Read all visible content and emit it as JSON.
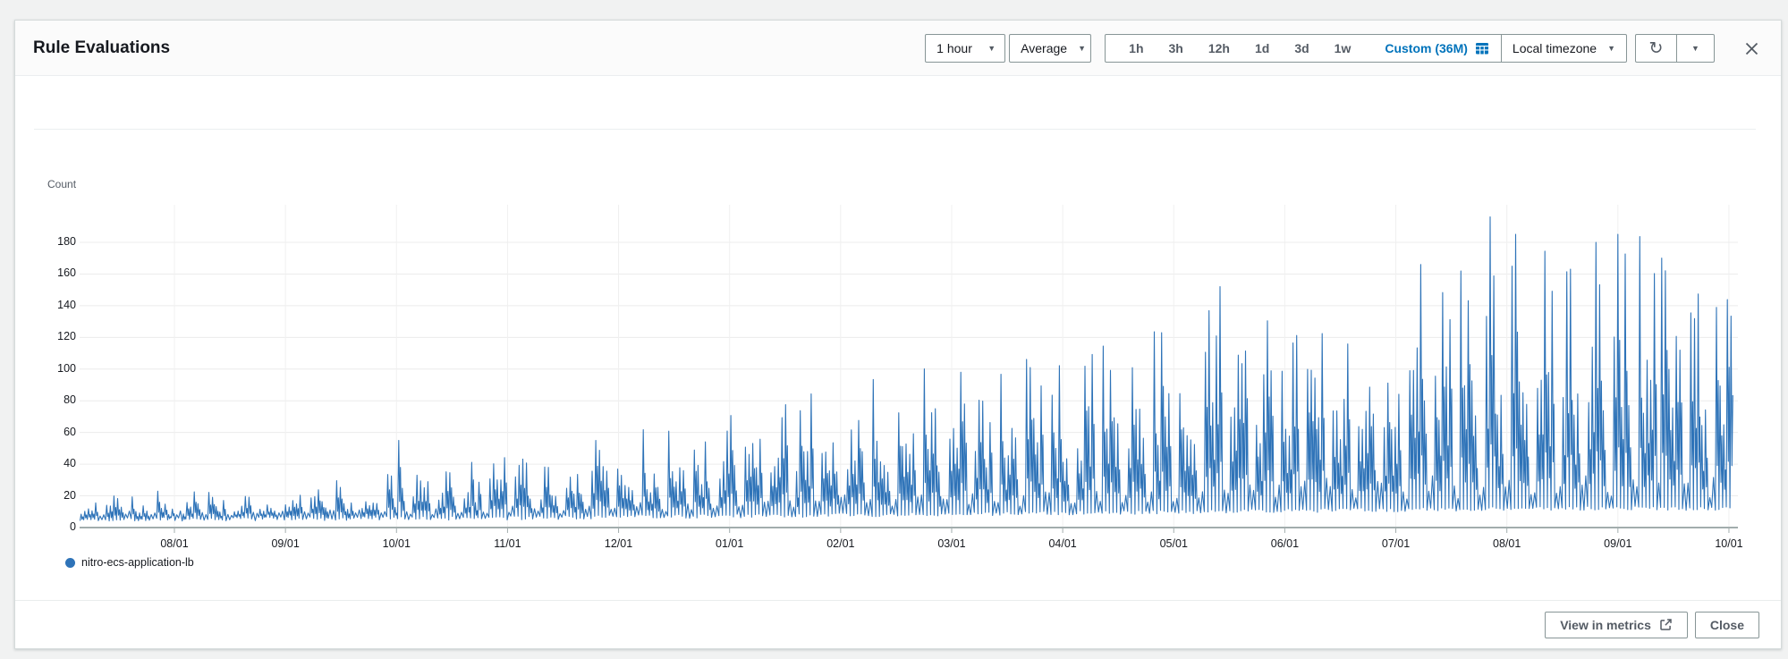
{
  "window": {
    "title": "Rule Evaluations"
  },
  "colors": {
    "accent": "#0073bb",
    "series_blue": "#2e73b8",
    "text": "#16191f",
    "muted_text": "#545b64",
    "control_border": "#879596",
    "page_background": "#f1f2f2"
  },
  "header": {
    "period_dropdown": {
      "value": "1 hour"
    },
    "statistic_dropdown": {
      "value": "Average"
    },
    "quick_ranges": [
      "1h",
      "3h",
      "12h",
      "1d",
      "3d",
      "1w"
    ],
    "custom_range_label": "Custom (36M)",
    "timezone_dropdown": {
      "value": "Local timezone"
    }
  },
  "footer": {
    "view_in_metrics_label": "View in metrics",
    "close_label": "Close"
  },
  "chart_data": {
    "type": "line",
    "title": "Rule Evaluations",
    "ylabel": "Count",
    "yticks": [
      180,
      160,
      140,
      120,
      100,
      80,
      60,
      40,
      20,
      0
    ],
    "ylim": [
      0,
      200
    ],
    "x_tick_labels": [
      "08/01",
      "09/01",
      "10/01",
      "11/01",
      "12/01",
      "01/01",
      "02/01",
      "03/01",
      "04/01",
      "05/01",
      "06/01",
      "07/01",
      "08/01",
      "09/01",
      "10/01"
    ],
    "grid": true,
    "grid_color": "#ececec",
    "vgrid_color": "#f0f0f0",
    "axis_color": "#a2adad",
    "legend_position": "bottom-left",
    "series": [
      {
        "name": "nitro-ecs-application-lb",
        "color": "#2e73b8"
      }
    ],
    "description": "Hourly rule-evaluation counts over ~15 months; strong weekday/weekend cycle; amplitude grows from ~20 to ~150 with outlier spikes.",
    "generation": {
      "seed": 1337,
      "days_per_month": 30.42,
      "months_before_first_tick": 0.85,
      "pre_start_peak": 15,
      "monthly_peak_envelope": [
        18,
        22,
        27,
        33,
        45,
        55,
        66,
        78,
        90,
        102,
        115,
        128,
        143,
        147,
        141
      ],
      "weekend_factor": 0.12,
      "base_min": 3,
      "spike_probability": 0.16,
      "spike_gain_min": 1.1,
      "spike_gain_max": 1.35,
      "spike_cap": 185,
      "notable_spikes": [
        {
          "month_offset": 2.0,
          "value": 55
        },
        {
          "month_offset": 9.4,
          "value": 152
        },
        {
          "month_offset": 11.2,
          "value": 166
        },
        {
          "month_offset": 11.85,
          "value": 196
        },
        {
          "month_offset": 12.55,
          "value": 163
        },
        {
          "month_offset": 12.8,
          "value": 180
        },
        {
          "month_offset": 13.4,
          "value": 170
        }
      ]
    }
  }
}
